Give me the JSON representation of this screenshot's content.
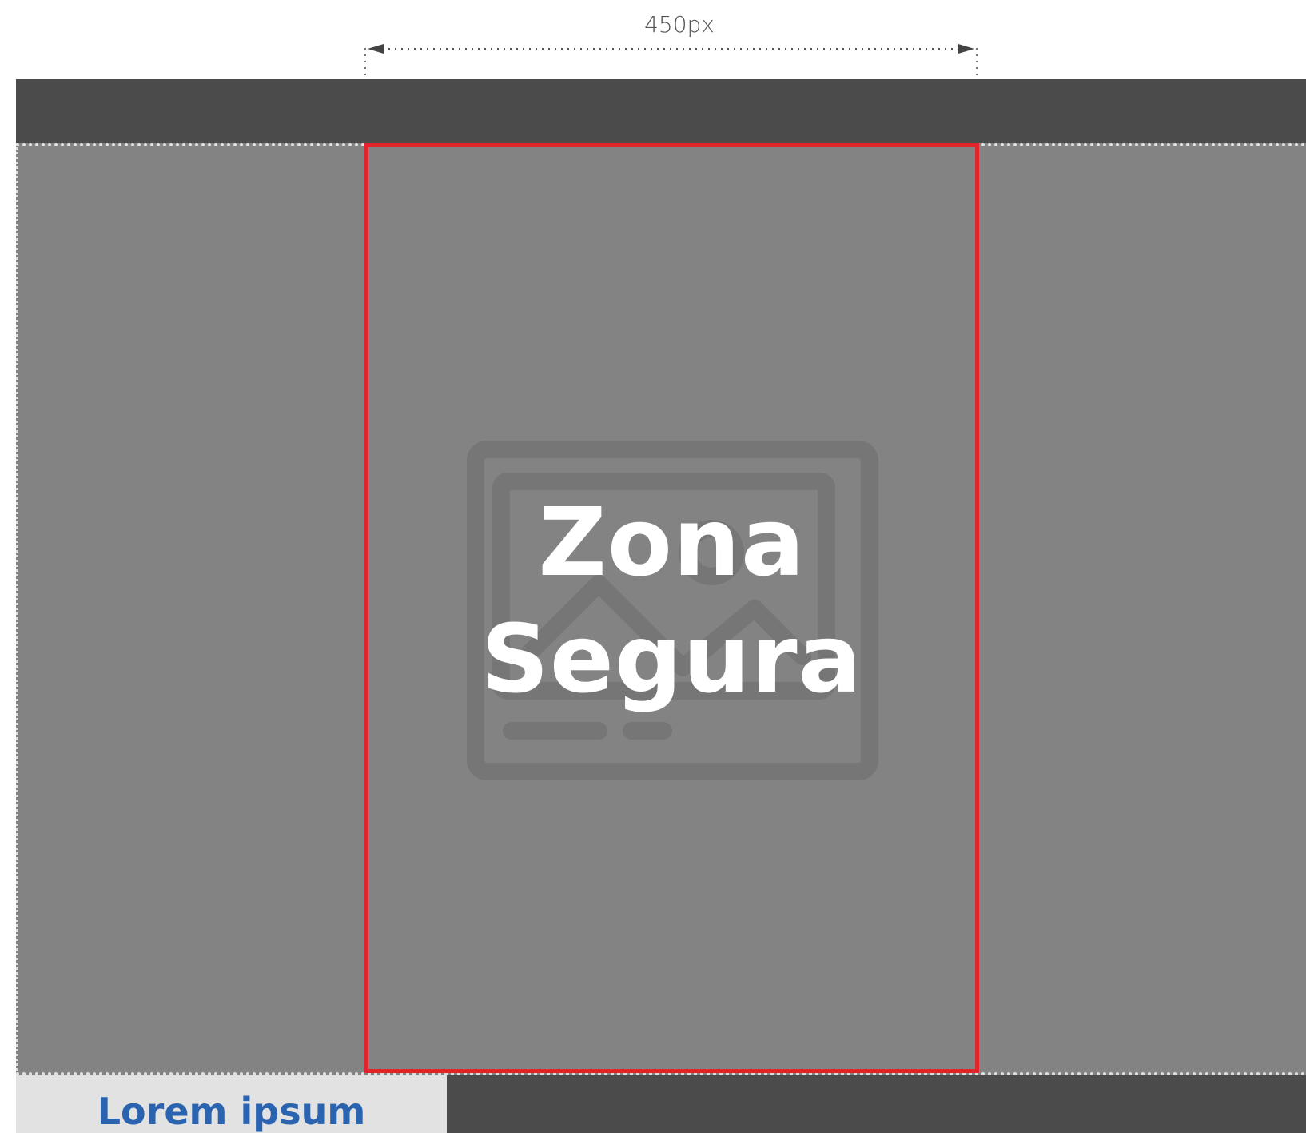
{
  "dimension": {
    "label": "450px"
  },
  "safe_zone": {
    "title_line1": "Zona",
    "title_line2": "Segura",
    "border_color": "#e0262c"
  },
  "bottom_tab": {
    "label": "Lorem ipsum",
    "text_color": "#2a63b0"
  },
  "colors": {
    "bar": "#4b4b4b",
    "area": "#838383",
    "tab": "#e2e2e2"
  },
  "icons": {
    "placeholder": "image-placeholder-icon"
  }
}
